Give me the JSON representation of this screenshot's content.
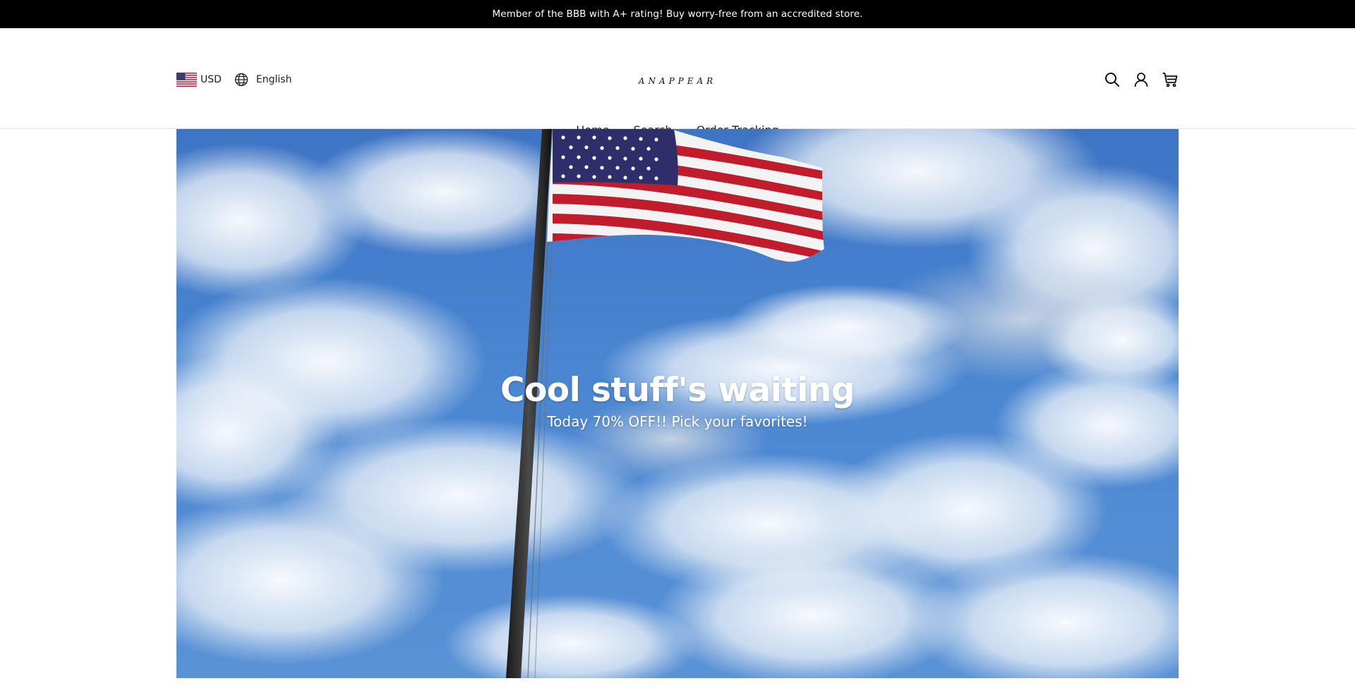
{
  "announcement": {
    "text": "Member of the BBB with A+ rating! Buy worry-free from an accredited store."
  },
  "header": {
    "currency": "USD",
    "language": "English",
    "logo_text": "ANAPPEAR",
    "icons": [
      "search-icon",
      "account-icon",
      "cart-icon"
    ]
  },
  "nav": {
    "items": [
      {
        "label": "Home"
      },
      {
        "label": "Search"
      },
      {
        "label": "Order Tracking"
      }
    ]
  },
  "hero": {
    "title": "Cool stuff's waiting",
    "subtitle": "Today 70% OFF!! Pick your favorites!"
  },
  "colors": {
    "announcement_bg": "#000000",
    "sky_blue": "#3e74c4",
    "flag_red": "#b22234",
    "flag_blue": "#3c3b6e"
  }
}
